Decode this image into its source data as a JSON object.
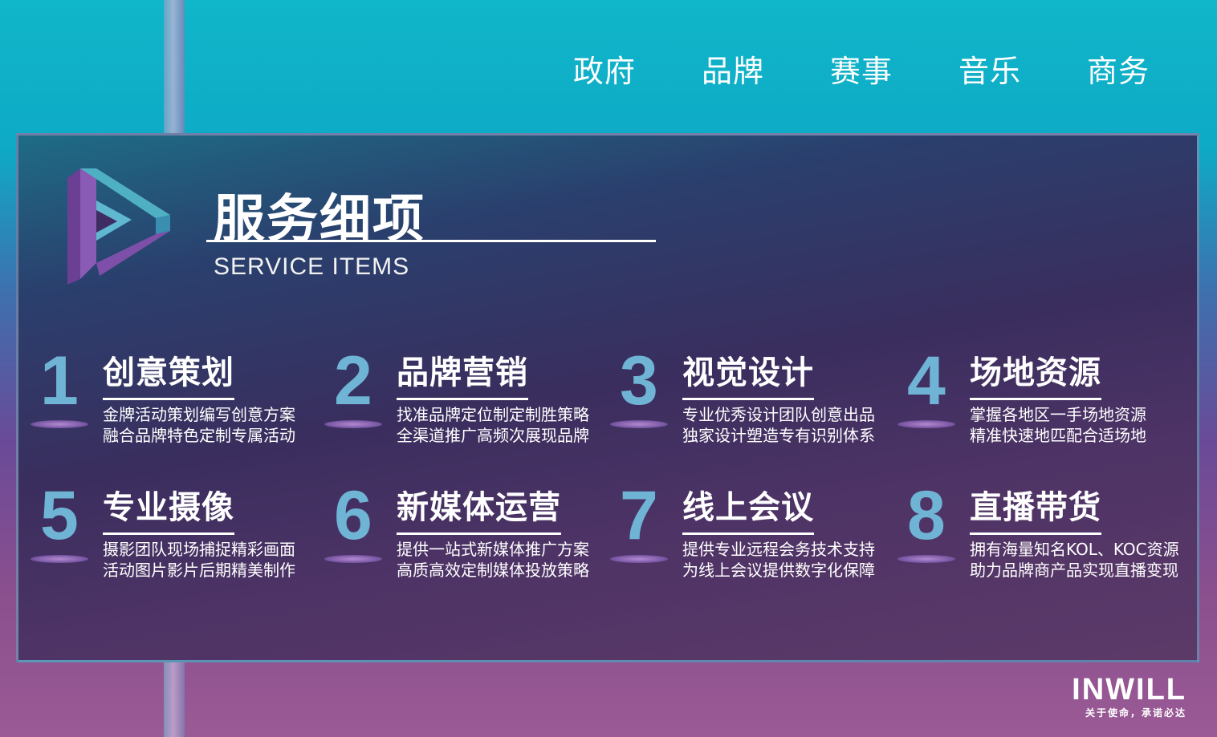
{
  "nav": {
    "items": [
      "政府",
      "品牌",
      "赛事",
      "音乐",
      "商务"
    ]
  },
  "section": {
    "title_cn": "服务细项",
    "title_en": "SERVICE ITEMS"
  },
  "services": [
    {
      "num": "1",
      "title": "创意策划",
      "line1": "金牌活动策划编写创意方案",
      "line2": "融合品牌特色定制专属活动"
    },
    {
      "num": "2",
      "title": "品牌营销",
      "line1": "找准品牌定位制定制胜策略",
      "line2": "全渠道推广高频次展现品牌"
    },
    {
      "num": "3",
      "title": "视觉设计",
      "line1": "专业优秀设计团队创意出品",
      "line2": "独家设计塑造专有识别体系"
    },
    {
      "num": "4",
      "title": "场地资源",
      "line1": "掌握各地区一手场地资源",
      "line2": "精准快速地匹配合适场地"
    },
    {
      "num": "5",
      "title": "专业摄像",
      "line1": "摄影团队现场捕捉精彩画面",
      "line2": "活动图片影片后期精美制作"
    },
    {
      "num": "6",
      "title": "新媒体运营",
      "line1": "提供一站式新媒体推广方案",
      "line2": "高质高效定制媒体投放策略"
    },
    {
      "num": "7",
      "title": "线上会议",
      "line1": "提供专业远程会务技术支持",
      "line2": "为线上会议提供数字化保障"
    },
    {
      "num": "8",
      "title": "直播带货",
      "line1": "拥有海量知名KOL、KOC资源",
      "line2": "助力品牌商产品实现直播变现"
    }
  ],
  "brand": {
    "name": "INWILL",
    "tagline": "关于使命，承诺必达"
  },
  "colors": {
    "number": "#6fb4d4",
    "accent": "#10b6c9"
  }
}
